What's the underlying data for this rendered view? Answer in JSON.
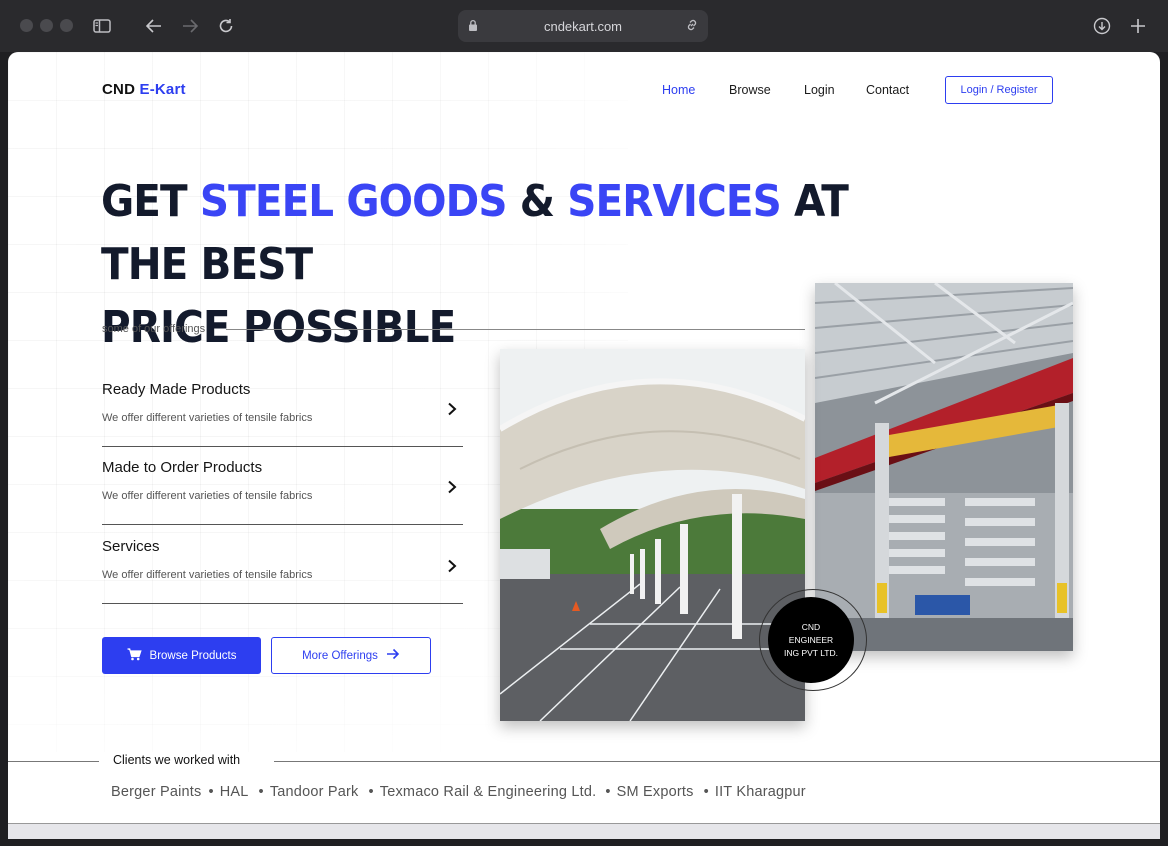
{
  "browser": {
    "url": "cndekart.com"
  },
  "nav": {
    "logo_prefix": "CND",
    "logo_accent": "E-Kart",
    "links": [
      "Home",
      "Browse",
      "Login",
      "Contact"
    ],
    "active": "Home",
    "login_register": "Login / Register"
  },
  "hero": {
    "line1_a": "GET ",
    "line1_b": "STEEL GOODS",
    "line1_c": " & ",
    "line1_d": "SERVICES",
    "line1_e": " AT THE BEST",
    "line2": "PRICE POSSIBLE"
  },
  "offerings": {
    "label": "some of our offerings",
    "items": [
      {
        "title": "Ready Made Products",
        "desc": "We offer different varieties of tensile fabrics"
      },
      {
        "title": "Made to Order Products",
        "desc": "We offer different varieties of tensile fabrics"
      },
      {
        "title": "Services",
        "desc": "We offer different varieties of tensile fabrics"
      }
    ]
  },
  "buttons": {
    "browse": "Browse Products",
    "more": "More Offerings"
  },
  "badge": {
    "line1": "CND",
    "line2": "ENGINEER",
    "line3": "ING PVT LTD."
  },
  "clients": {
    "title": "Clients we worked with",
    "names": [
      "Berger Paints",
      "HAL",
      "Tandoor Park",
      "Texmaco Rail & Engineering Ltd.",
      "SM Exports",
      "IIT Kharagpur"
    ],
    "separator": "•"
  },
  "colors": {
    "accent": "#2d3ef0",
    "headline": "#131a2c",
    "headline_accent": "#3a45f5"
  }
}
